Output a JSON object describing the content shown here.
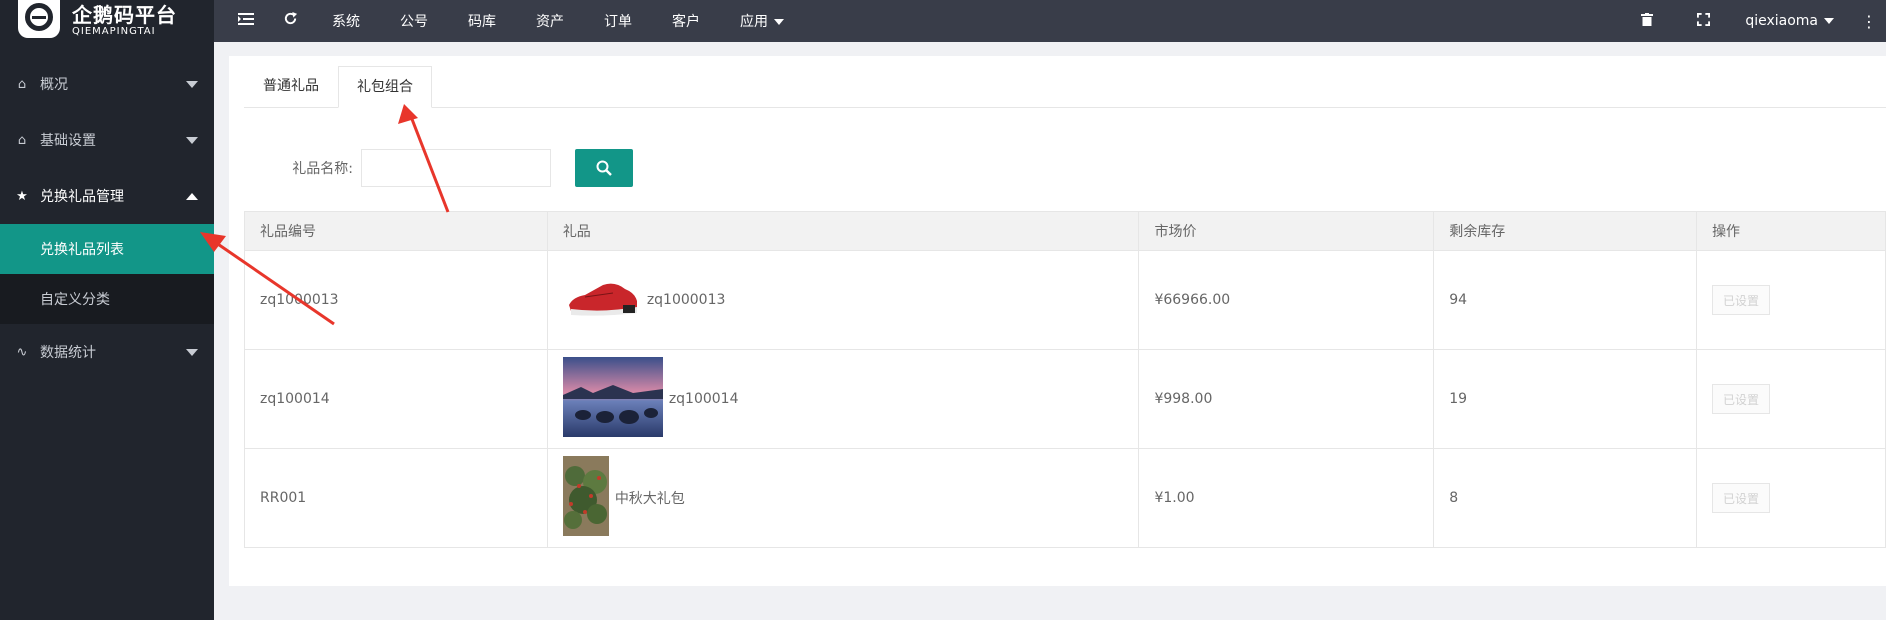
{
  "brand": {
    "name_cn": "企鹅码平台",
    "name_en": "QIEMAPINGTAI"
  },
  "sidebar": {
    "items": [
      {
        "label": "概况",
        "icon": "home-icon"
      },
      {
        "label": "基础设置",
        "icon": "home-icon"
      },
      {
        "label": "兑换礼品管理",
        "icon": "star-icon",
        "open": true,
        "children": [
          {
            "label": "兑换礼品列表",
            "active": true
          },
          {
            "label": "自定义分类"
          }
        ]
      },
      {
        "label": "数据统计",
        "icon": "pulse-icon"
      }
    ]
  },
  "topbar": {
    "menus": [
      "系统",
      "公号",
      "码库",
      "资产",
      "订单",
      "客户",
      "应用"
    ],
    "user": "qiexiaoma"
  },
  "tabs": [
    "普通礼品",
    "礼包组合"
  ],
  "search": {
    "label": "礼品名称:",
    "placeholder": ""
  },
  "table": {
    "headers": [
      "礼品编号",
      "礼品",
      "市场价",
      "剩余库存",
      "操作"
    ],
    "rows": [
      {
        "id": "zq1000013",
        "gift": "zq1000013",
        "price": "¥66966.00",
        "stock": "94",
        "action": "已设置"
      },
      {
        "id": "zq100014",
        "gift": "zq100014",
        "price": "¥998.00",
        "stock": "19",
        "action": "已设置"
      },
      {
        "id": "RR001",
        "gift": "中秋大礼包",
        "price": "¥1.00",
        "stock": "8",
        "action": "已设置"
      }
    ]
  },
  "colors": {
    "accent": "#129688",
    "sidebar_bg": "#21252d",
    "topbar_bg": "#393d49",
    "annotation": "#e8362b"
  }
}
